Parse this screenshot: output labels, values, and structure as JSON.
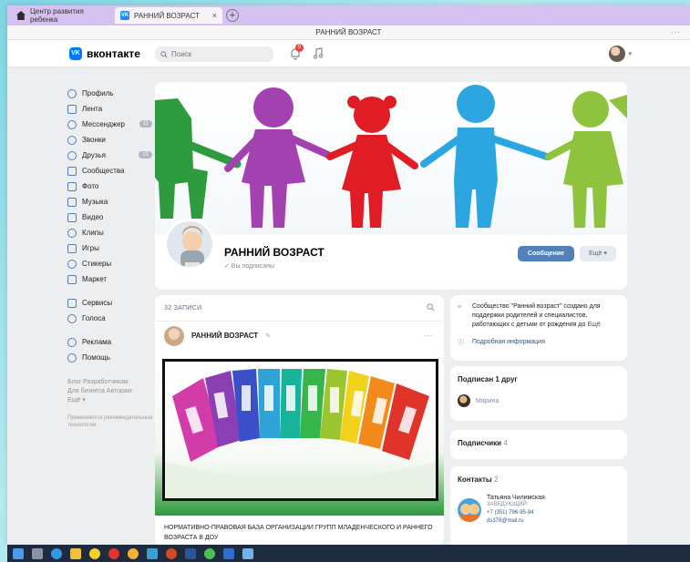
{
  "browser": {
    "tabs": [
      {
        "label": "Центр развития ребенка",
        "active": false
      },
      {
        "label": "РАННИЙ ВОЗРАСТ",
        "active": true,
        "close": "×"
      }
    ],
    "new_tab": "+",
    "window_title": "РАННИЙ ВОЗРАСТ",
    "menu_dots": "···"
  },
  "header": {
    "logo_text": "вконтакте",
    "logo_badge": "VK",
    "search_placeholder": "Поиск",
    "notification_count": "9"
  },
  "sidebar": {
    "items": [
      {
        "label": "Профиль",
        "icon": "profile-icon"
      },
      {
        "label": "Лента",
        "icon": "feed-icon"
      },
      {
        "label": "Мессенджер",
        "icon": "messenger-icon",
        "count": "11"
      },
      {
        "label": "Звонки",
        "icon": "phone-icon"
      },
      {
        "label": "Друзья",
        "icon": "friends-icon",
        "count": "13"
      },
      {
        "label": "Сообщества",
        "icon": "communities-icon"
      },
      {
        "label": "Фото",
        "icon": "photo-icon"
      },
      {
        "label": "Музыка",
        "icon": "music-icon"
      },
      {
        "label": "Видео",
        "icon": "video-icon"
      },
      {
        "label": "Клипы",
        "icon": "clips-icon"
      },
      {
        "label": "Игры",
        "icon": "games-icon"
      },
      {
        "label": "Стикеры",
        "icon": "stickers-icon"
      },
      {
        "label": "Маркет",
        "icon": "market-icon"
      }
    ],
    "items2": [
      {
        "label": "Сервисы",
        "icon": "services-icon"
      },
      {
        "label": "Голоса",
        "icon": "voices-icon"
      }
    ],
    "items3": [
      {
        "label": "Реклама",
        "icon": "ads-icon"
      },
      {
        "label": "Помощь",
        "icon": "help-icon"
      }
    ],
    "footer_line1": "Блог  Разработчикам",
    "footer_line2": "Для бизнеса  Авторам",
    "footer_line3": "Ещё ▾",
    "footer_note": "Применяются рекомендательные технологии"
  },
  "profile": {
    "name": "РАННИЙ ВОЗРАСТ",
    "subscribed": "✓ Вы подписаны",
    "message_button": "Сообщение",
    "more_button": "Ещё ▾"
  },
  "wall": {
    "count_label": "32 ЗАПИСИ",
    "post_author": "РАННИЙ ВОЗРАСТ",
    "post_text": "НОРМАТИВНО-ПРАВОВАЯ БАЗА ОРГАНИЗАЦИИ ГРУПП МЛАДЕНЧЕСКОГО И РАННЕГО ВОЗРАСТА В ДОУ"
  },
  "about": {
    "text": "Сообщество \"Ранний возраст\" создано для поддержки родителей и специалистов, работающих с детьми от рождения до",
    "more": "Ещё",
    "link": "Подробная информация"
  },
  "friends": {
    "title": "Подписан 1 друг",
    "friend_name": "Марина"
  },
  "subscribers": {
    "title": "Подписчики",
    "count": "4"
  },
  "contacts": {
    "title": "Контакты",
    "count": "2",
    "name": "Татьяна Чилимская",
    "role": "ЗАВЕДУЮЩИЙ",
    "phone": "+7 (351) 796-95-94",
    "email": "ds378@mail.ru"
  },
  "colors": {
    "vk_blue": "#0077ff",
    "button_blue": "#5181b8",
    "link_blue": "#2a5885",
    "tab_strip": "#d6c2f0"
  }
}
